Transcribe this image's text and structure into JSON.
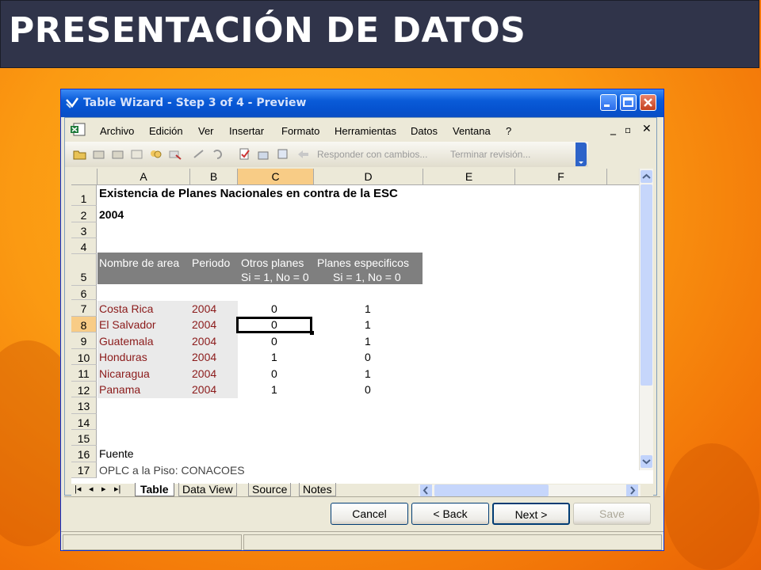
{
  "slide": {
    "title": "PRESENTACIÓN DE DATOS"
  },
  "window": {
    "title": "Table Wizard - Step 3 of 4 - Preview",
    "controls": [
      "minimize-icon",
      "maximize-icon",
      "close-icon"
    ]
  },
  "menubar": {
    "items": [
      {
        "label": "Archivo",
        "mnemonic": "A"
      },
      {
        "label": "Edición",
        "mnemonic": "E"
      },
      {
        "label": "Ver",
        "mnemonic": "V"
      },
      {
        "label": "Insertar",
        "mnemonic": "I"
      },
      {
        "label": "Formato",
        "mnemonic": "F"
      },
      {
        "label": "Herramientas",
        "mnemonic": "H"
      },
      {
        "label": "Datos",
        "mnemonic": "t"
      },
      {
        "label": "Ventana",
        "mnemonic": "n"
      },
      {
        "label": "?",
        "mnemonic": "?"
      }
    ]
  },
  "toolbar": {
    "reply_label": "Responder con cambios...",
    "end_review_label": "Terminar revisión..."
  },
  "sheet": {
    "columns": [
      "A",
      "B",
      "C",
      "D",
      "E",
      "F"
    ],
    "selected_column": "C",
    "rows": [
      "1",
      "2",
      "3",
      "4",
      "5",
      "6",
      "7",
      "8",
      "9",
      "10",
      "11",
      "12",
      "13",
      "14",
      "15",
      "16",
      "17"
    ],
    "selected_row": "8",
    "title": "Existencia de Planes Nacionales en contra de la ESC",
    "year": "2004",
    "headers": {
      "col_a": "Nombre de area",
      "col_b": "Periodo",
      "col_c_1": "Otros planes",
      "col_c_2": "Si = 1, No = 0",
      "col_d_1": "Planes especificos",
      "col_d_2": "Si = 1, No = 0"
    },
    "data": [
      {
        "area": "Costa Rica",
        "periodo": "2004",
        "otros": "0",
        "especificos": "1"
      },
      {
        "area": "El Salvador",
        "periodo": "2004",
        "otros": "0",
        "especificos": "1"
      },
      {
        "area": "Guatemala",
        "periodo": "2004",
        "otros": "0",
        "especificos": "1"
      },
      {
        "area": "Honduras",
        "periodo": "2004",
        "otros": "1",
        "especificos": "0"
      },
      {
        "area": "Nicaragua",
        "periodo": "2004",
        "otros": "0",
        "especificos": "1"
      },
      {
        "area": "Panama",
        "periodo": "2004",
        "otros": "1",
        "especificos": "0"
      }
    ],
    "fuente": "Fuente",
    "row17_partial": "OPLC a la Piso: CONACOES"
  },
  "sheet_tabs": [
    "Table",
    "Data View",
    "Source",
    "Notes"
  ],
  "active_sheet_tab": "Table",
  "buttons": {
    "cancel": "Cancel",
    "back": "< Back",
    "next": "Next >",
    "save": "Save"
  }
}
